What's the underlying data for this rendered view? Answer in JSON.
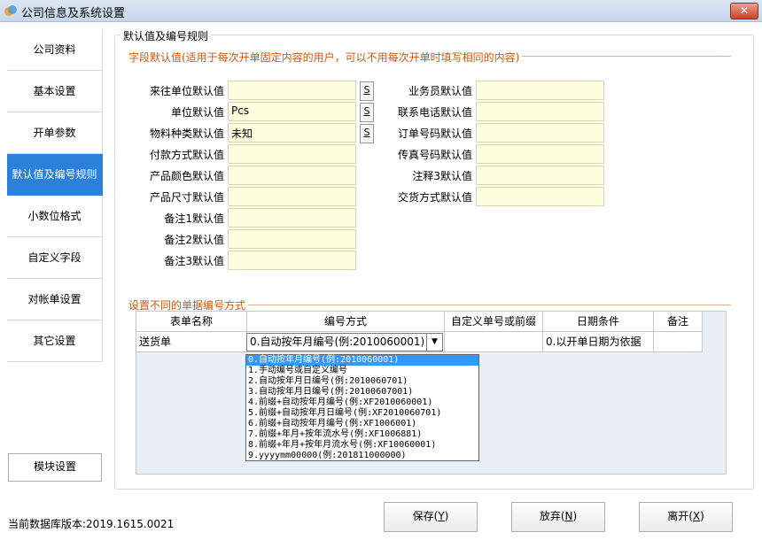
{
  "window": {
    "title": "公司信息及系统设置",
    "close": "✕"
  },
  "nav": {
    "items": [
      "公司资料",
      "基本设置",
      "开单参数",
      "默认值及编号规则",
      "小数位格式",
      "自定义字段",
      "对帐单设置",
      "其它设置"
    ],
    "active_index": 3,
    "module_button": "模块设置"
  },
  "panel": {
    "title": "默认值及编号规则",
    "section1": "字段默认值(适用于每次开单固定内容的用户，可以不用每次开单时填写相同的内容)",
    "left_fields": [
      {
        "label": "来往单位默认值",
        "value": "",
        "has_s": true
      },
      {
        "label": "单位默认值",
        "value": "Pcs",
        "has_s": true
      },
      {
        "label": "物料种类默认值",
        "value": "未知",
        "has_s": true
      },
      {
        "label": "付款方式默认值",
        "value": "",
        "has_s": false
      },
      {
        "label": "产品颜色默认值",
        "value": "",
        "has_s": false
      },
      {
        "label": "产品尺寸默认值",
        "value": "",
        "has_s": false
      },
      {
        "label": "备注1默认值",
        "value": "",
        "has_s": false
      },
      {
        "label": "备注2默认值",
        "value": "",
        "has_s": false
      },
      {
        "label": "备注3默认值",
        "value": "",
        "has_s": false
      }
    ],
    "right_fields": [
      {
        "label": "业务员默认值",
        "value": ""
      },
      {
        "label": "联系电话默认值",
        "value": ""
      },
      {
        "label": "订单号码默认值",
        "value": ""
      },
      {
        "label": "传真号码默认值",
        "value": ""
      },
      {
        "label": "注释3默认值",
        "value": ""
      },
      {
        "label": "交货方式默认值",
        "value": ""
      }
    ],
    "s_label": "S",
    "section2": "设置不同的单据编号方式",
    "table": {
      "headers": [
        "表单名称",
        "编号方式",
        "自定义单号或前缀",
        "日期条件",
        "备注"
      ],
      "row": {
        "name": "送货单",
        "mode": "0.自动按年月编号(例:2010060001)",
        "prefix": "",
        "date_cond": "0.以开单日期为依据",
        "note": ""
      }
    },
    "dropdown_options": [
      "0.自动按年月编号(例:2010060001)",
      "1.手动编号或自定义编号",
      "2.自动按年月日编号(例:2010060701)",
      "3.自动按年月日编号(例:20100607001)",
      "4.前缀+自动按年月编号(例:XF2010060001)",
      "5.前缀+自动按年月日编号(例:XF2010060701)",
      "6.前缀+自动按年月编号(例:XF1006001)",
      "7.前缀+年月+按年流水号(例:XF1006881)",
      "8.前缀+年月+按年月流水号(例:XF10060001)",
      "9.yyyymm00000(例:201811000000)"
    ],
    "dropdown_selected": 0
  },
  "footer": {
    "db_version": "当前数据库版本:2019.1615.0021",
    "save": "保存(",
    "save_key": "Y",
    "cancel": "放弃(",
    "cancel_key": "N",
    "exit": "离开(",
    "exit_key": "X",
    "close_paren": ")"
  }
}
